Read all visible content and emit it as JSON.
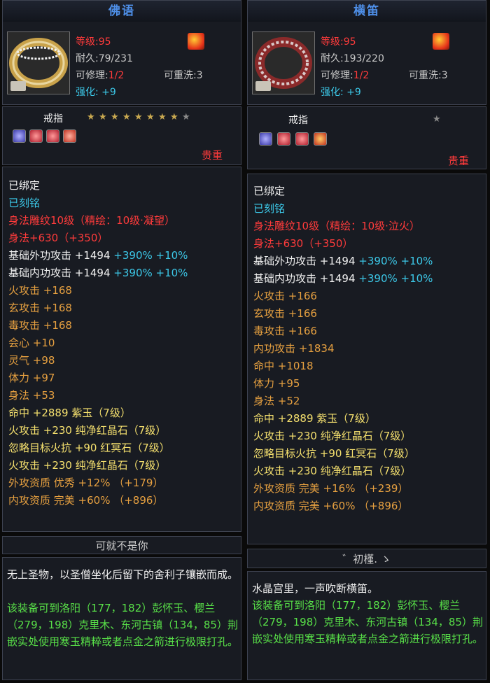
{
  "colors": {
    "red": "#ff3b3b",
    "gray": "#c8c8c8",
    "cyan": "#3cc8e8",
    "yellow": "#f5e06e",
    "orange": "#e6a040",
    "green": "#58e048",
    "title": "#4e8fe8"
  },
  "left": {
    "title": "佛语",
    "level": "等级:95",
    "durability": "耐久:79/231",
    "repair_label": "可修理:",
    "repair_value": "1/2",
    "rewash": "可重洗:3",
    "enhance_label": "强化:",
    "enhance_value": "+9",
    "item_type": "戒指",
    "stars_filled": 8,
    "stars_total": 9,
    "gems": [
      "blue-gem-icon",
      "red-gem-icon",
      "red-gem-icon",
      "red-gem-icon"
    ],
    "rarity": "贵重",
    "status": {
      "bound": "已绑定",
      "engraved": "已刻铭"
    },
    "carved": "身法雕纹10级（精绘：10级·凝望）",
    "carved_bonus": "身法+630（+350）",
    "stats": [
      {
        "text": "基础外功攻击 +1494",
        "extra": " +390% +10%"
      },
      {
        "text": "基础内功攻击 +1494",
        "extra": " +390% +10%"
      },
      {
        "text": "火攻击 +168"
      },
      {
        "text": "玄攻击 +168"
      },
      {
        "text": "毒攻击 +168"
      },
      {
        "text": "会心 +10"
      },
      {
        "text": "灵气 +98"
      },
      {
        "text": "体力 +97"
      },
      {
        "text": "身法 +53"
      }
    ],
    "gem_stats": [
      "命中 +2889 紫玉（7级）",
      "火攻击 +230 纯净红晶石（7级）",
      "忽略目标火抗 +90 红冥石（7级）",
      "火攻击 +230 纯净红晶石（7级）"
    ],
    "aptitudes": [
      "外攻资质  优秀 +12% （+179）",
      "内攻资质  完美 +60% （+896）"
    ],
    "signature": "可就不是你",
    "desc_white": "无上圣物，以圣僧坐化后留下的舍利子镶嵌而成。",
    "desc_green": "该装备可到洛阳（177，182）彭怀玉、樱兰（279，198）克里木、东河古镇（134，85）荆嵌实处使用寒玉精粹或者点金之箭进行极限打孔。"
  },
  "right": {
    "title": "横笛",
    "level": "等级:95",
    "durability": "耐久:193/220",
    "repair_label": "可修理:",
    "repair_value": "1/2",
    "rewash": "可重洗:3",
    "enhance_label": "强化:",
    "enhance_value": "+9",
    "item_type": "戒指",
    "stars_filled": 0,
    "stars_total": 1,
    "gems": [
      "blue-gem-icon",
      "red-gem-icon",
      "red-gem-icon",
      "red-gem-icon"
    ],
    "rarity": "贵重",
    "status": {
      "bound": "已绑定",
      "engraved": "已刻铭"
    },
    "carved": "身法雕纹10级（精绘：10级·泣火）",
    "carved_bonus": "身法+630（+350）",
    "stats": [
      {
        "text": "基础外功攻击 +1494",
        "extra": " +390% +10%"
      },
      {
        "text": "基础内功攻击 +1494",
        "extra": " +390% +10%"
      },
      {
        "text": "火攻击 +166"
      },
      {
        "text": "玄攻击 +166"
      },
      {
        "text": "毒攻击 +166"
      },
      {
        "text": "内功攻击 +1834"
      },
      {
        "text": "命中 +1018"
      },
      {
        "text": "体力 +95"
      },
      {
        "text": "身法 +52"
      }
    ],
    "gem_stats": [
      "命中 +2889 紫玉（7级）",
      "火攻击 +230 纯净红晶石（7级）",
      "忽略目标火抗 +90 红冥石（7级）",
      "火攻击 +230 纯净红晶石（7级）"
    ],
    "aptitudes": [
      "外攻资质  完美 +16% （+239）",
      "内攻资质  完美 +60% （+896）"
    ],
    "signature": "゛初槿. ゝ",
    "desc_white": "水晶宫里，一声吹断横笛。",
    "desc_green": "该装备可到洛阳（177，182）彭怀玉、樱兰（279，198）克里木、东河古镇（134，85）荆嵌实处使用寒玉精粹或者点金之箭进行极限打孔。"
  }
}
